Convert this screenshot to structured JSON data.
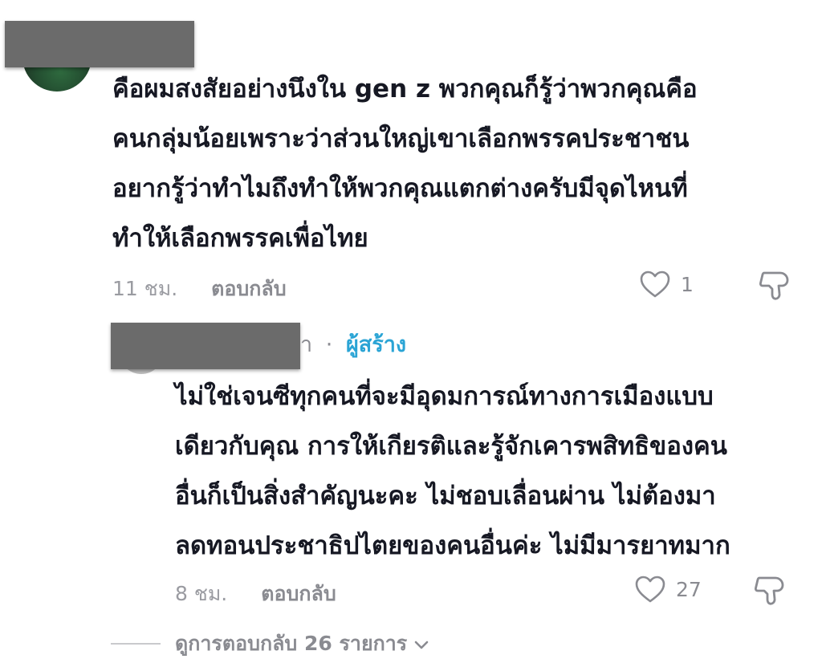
{
  "comment": {
    "lines": [
      "คือผมสงสัยอย่างนึงใน gen z พวกคุณก็รู้ว่าพวกคุณคือ",
      "คนกลุ่มน้อยเพราะว่าส่วนใหญ่เขาเลือกพรรคประชาชน",
      "อยากรู้ว่าทำไมถึงทำให้พวกคุณแตกต่างครับมีจุดไหนที่",
      "ทำให้เลือกพรรคเพื่อไทย"
    ],
    "time": "11 ชม.",
    "reply_label": "ตอบกลับ",
    "likes": "1"
  },
  "reply": {
    "name_tail": "า",
    "separator": "·",
    "creator_badge": "ผู้สร้าง",
    "lines": [
      "ไม่ใช่เจนซีทุกคนที่จะมีอุดมการณ์ทางการเมืองแบบ",
      "เดียวกับคุณ การให้เกียรติและรู้จักเคารพสิทธิของคน",
      "อื่นก็เป็นสิ่งสำคัญนะคะ ไม่ชอบเลื่อนผ่าน ไม่ต้องมา",
      "ลดทอนประชาธิปไตยของคนอื่นค่ะ ไม่มีมารยาทมาก"
    ],
    "time": "8 ชม.",
    "reply_label": "ตอบกลับ",
    "likes": "27"
  },
  "view_replies": {
    "label": "ดูการตอบกลับ 26 รายการ",
    "icon": "chevron-down-icon"
  },
  "colors": {
    "text": "#161823",
    "muted": "#8a8b91",
    "creator": "#2aa4d5",
    "redaction": "#6b6b6b"
  }
}
